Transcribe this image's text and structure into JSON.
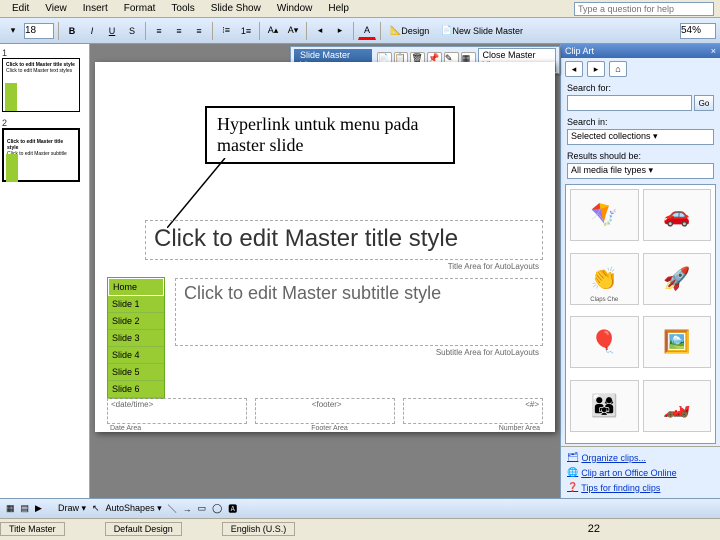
{
  "menubar": {
    "items": [
      "Edit",
      "View",
      "Insert",
      "Format",
      "Tools",
      "Slide Show",
      "Window",
      "Help"
    ],
    "help_placeholder": "Type a question for help"
  },
  "toolbar": {
    "font_size": "18",
    "bold": "B",
    "italic": "I",
    "underline": "U",
    "design_label": "Design",
    "new_master_label": "New Slide Master",
    "zoom": "54%"
  },
  "floating": {
    "title": "Slide Master View",
    "close": "Close Master View"
  },
  "thumbs": [
    {
      "num": "1",
      "title": "Click to edit Master title style",
      "sub": "Click to edit Master text styles"
    },
    {
      "num": "2",
      "title": "Click to edit Master title style",
      "sub": "Click to edit Master subtitle style"
    }
  ],
  "annotation": "Hyperlink untuk menu pada master slide",
  "slide": {
    "title_ph": "Click to edit Master title style",
    "title_area_lbl": "Title Area for AutoLayouts",
    "subtitle_ph": "Click to edit Master subtitle style",
    "subtitle_area_lbl": "Subtitle Area for AutoLayouts",
    "menu_items": [
      "Home",
      "Slide 1",
      "Slide 2",
      "Slide 3",
      "Slide 4",
      "Slide 5",
      "Slide 6"
    ],
    "footers": [
      {
        "ph": "<date/time>",
        "lbl": "Date Area"
      },
      {
        "ph": "<footer>",
        "lbl": "Footer Area"
      },
      {
        "ph": "<#>",
        "lbl": "Number Area"
      }
    ]
  },
  "clipart": {
    "title": "Clip Art",
    "search_for_lbl": "Search for:",
    "search_val": "",
    "go": "Go",
    "search_in_lbl": "Search in:",
    "search_in_val": "Selected collections",
    "results_lbl": "Results should be:",
    "results_val": "All media file types",
    "clips": [
      {
        "emoji": "🪁",
        "cap": ""
      },
      {
        "emoji": "🚗",
        "cap": ""
      },
      {
        "emoji": "👏",
        "cap": "Claps Che"
      },
      {
        "emoji": "🚀",
        "cap": ""
      },
      {
        "emoji": "🎈",
        "cap": ""
      },
      {
        "emoji": "🖼️",
        "cap": ""
      },
      {
        "emoji": "👨‍👩‍👧",
        "cap": ""
      },
      {
        "emoji": "🏎️",
        "cap": ""
      }
    ],
    "links": [
      "Organize clips...",
      "Clip art on Office Online",
      "Tips for finding clips"
    ]
  },
  "drawbar": {
    "draw": "Draw ▾",
    "autoshapes": "AutoShapes ▾"
  },
  "status": {
    "slide": "Title Master",
    "design": "Default Design",
    "lang": "English (U.S.)",
    "page": "22"
  }
}
